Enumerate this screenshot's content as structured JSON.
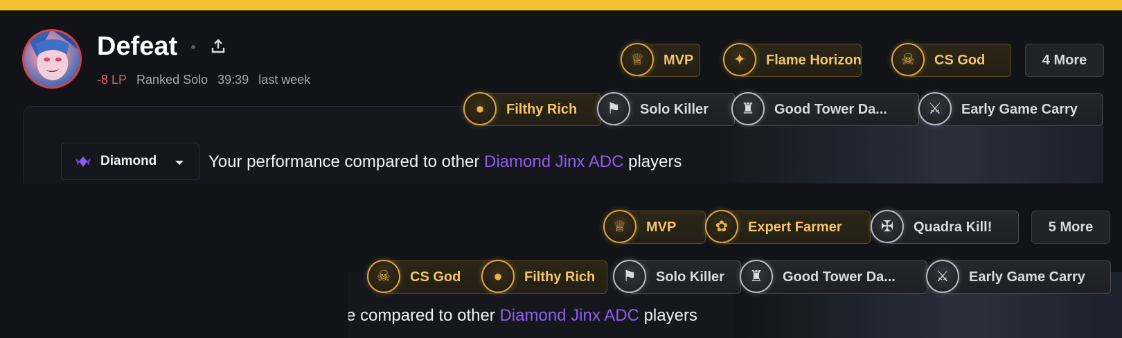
{
  "header": {
    "result": "Defeat",
    "lp_change": "-8 LP",
    "queue": "Ranked Solo",
    "duration": "39:39",
    "when": "last week"
  },
  "badges_top": [
    {
      "label": "MVP",
      "tier": "gold",
      "icon": "mvp-icon"
    },
    {
      "label": "Flame Horizon",
      "tier": "gold",
      "icon": "flame-horizon-icon"
    },
    {
      "label": "CS God",
      "tier": "gold",
      "icon": "cs-god-icon"
    },
    {
      "label": "4 More",
      "tier": "more"
    },
    {
      "label": "Filthy Rich",
      "tier": "gold",
      "icon": "money-bag-icon"
    },
    {
      "label": "Solo Killer",
      "tier": "silver",
      "icon": "solo-killer-icon"
    },
    {
      "label": "Good Tower Da...",
      "tier": "silver",
      "icon": "tower-icon"
    },
    {
      "label": "Early Game Carry",
      "tier": "silver",
      "icon": "early-carry-icon"
    }
  ],
  "comparison": {
    "rank_label": "Diamond",
    "prefix": "Your performance compared to other",
    "highlight": "Diamond Jinx ADC",
    "suffix": "players",
    "prefix_partial": "e compared to other"
  },
  "badges_bottom": [
    {
      "label": "MVP",
      "tier": "gold",
      "icon": "mvp-icon"
    },
    {
      "label": "Expert Farmer",
      "tier": "gold",
      "icon": "expert-farmer-icon"
    },
    {
      "label": "Quadra Kill!",
      "tier": "silver",
      "icon": "quadra-kill-icon"
    },
    {
      "label": "5 More",
      "tier": "more"
    },
    {
      "label": "CS God",
      "tier": "gold",
      "icon": "cs-god-icon"
    },
    {
      "label": "Filthy Rich",
      "tier": "gold",
      "icon": "money-bag-icon"
    },
    {
      "label": "Solo Killer",
      "tier": "silver",
      "icon": "solo-killer-icon"
    },
    {
      "label": "Good Tower Da...",
      "tier": "silver",
      "icon": "tower-icon"
    },
    {
      "label": "Early Game Carry",
      "tier": "silver",
      "icon": "early-carry-icon"
    }
  ],
  "colors": {
    "accent_purple": "#8d5cf0",
    "loss_red": "#e05c5c",
    "gold": "#f2c56b",
    "banner_yellow": "#f2c12e"
  }
}
